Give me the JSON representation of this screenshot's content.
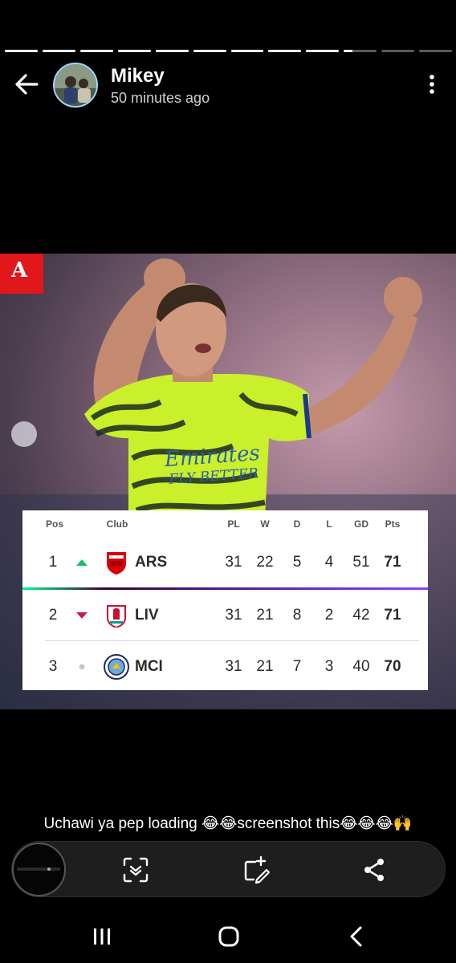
{
  "story": {
    "segments_total": 12,
    "segments_viewed": 9,
    "current_segment_progress": 0.25
  },
  "header": {
    "name": "Mikey",
    "time": "50 minutes ago"
  },
  "image": {
    "shirt_text_1": "Emirates",
    "shirt_text_2": "FLY BETTER",
    "table": {
      "columns": [
        "Pos",
        "Club",
        "PL",
        "W",
        "D",
        "L",
        "GD",
        "Pts"
      ],
      "rows": [
        {
          "pos": "1",
          "trend": "up",
          "club": "ARS",
          "pl": "31",
          "w": "22",
          "d": "5",
          "l": "4",
          "gd": "51",
          "pts": "71"
        },
        {
          "pos": "2",
          "trend": "down",
          "club": "LIV",
          "pl": "31",
          "w": "21",
          "d": "8",
          "l": "2",
          "gd": "42",
          "pts": "71"
        },
        {
          "pos": "3",
          "trend": "same",
          "club": "MCI",
          "pl": "31",
          "w": "21",
          "d": "7",
          "l": "3",
          "gd": "40",
          "pts": "70"
        }
      ]
    }
  },
  "caption": "Uchawi ya pep loading 😂😂screenshot this😂😂😂🙌",
  "colors": {
    "up": "#1bbf6b",
    "down": "#c2185b",
    "same": "#c8c8c8"
  }
}
